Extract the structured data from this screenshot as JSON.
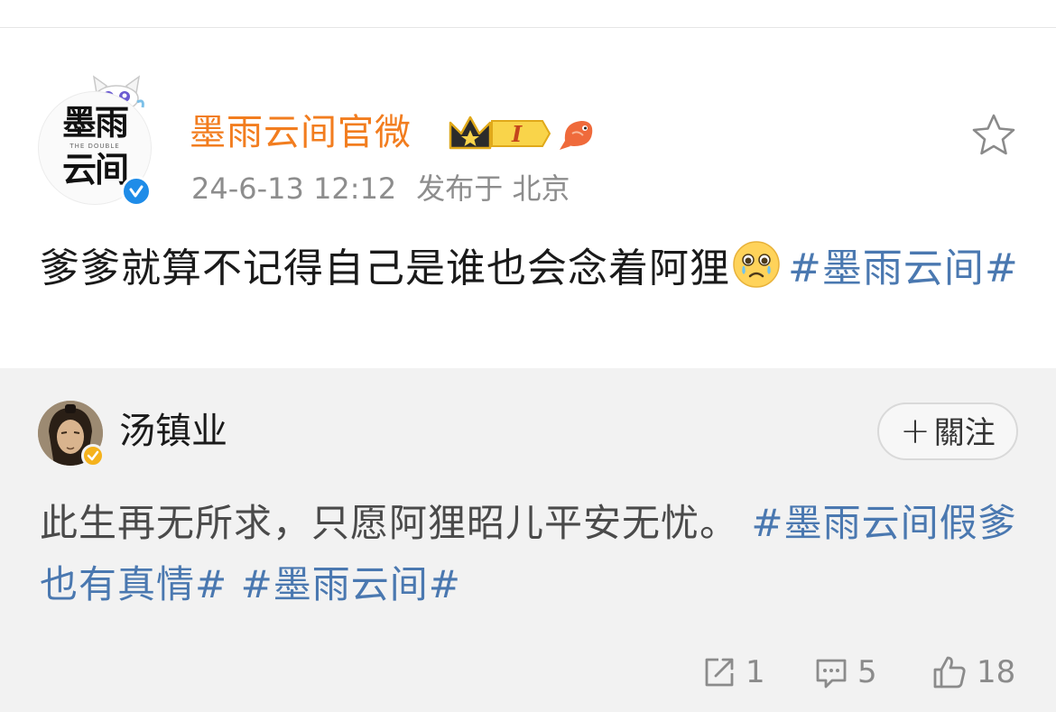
{
  "post": {
    "author": "墨雨云间官微",
    "timestamp": "24-6-13 12:12",
    "location": "发布于 北京",
    "level_badge": "I",
    "text_main": "爹爹就算不记得自己是谁也会念着阿狸",
    "hashtag": "#墨雨云间#",
    "logo": {
      "line1": "墨雨",
      "line2": "云间",
      "sub": "THE DOUBLE"
    },
    "icons": [
      "cat-icon",
      "verified-icon",
      "crown-icon",
      "fish-icon",
      "star-icon",
      "crying-face-emoji"
    ]
  },
  "repost": {
    "author": "汤镇业",
    "follow_label": "關注",
    "follow_plus": "+",
    "text_main": "此生再无所求，只愿阿狸昭儿平安无忧。",
    "hashtag1": "#墨雨云间假爹也有真情#",
    "hashtag2": "#墨雨云间#"
  },
  "actions": {
    "repost_count": "1",
    "comment_count": "5",
    "like_count": "18"
  },
  "colors": {
    "author_orange": "#f27d1f",
    "hashtag_blue": "#4a78b0",
    "meta_gray": "#8d8d8d",
    "repost_bg": "#f2f2f2",
    "verified_blue": "#1f8ce8",
    "verified_gold": "#f5b21c"
  }
}
